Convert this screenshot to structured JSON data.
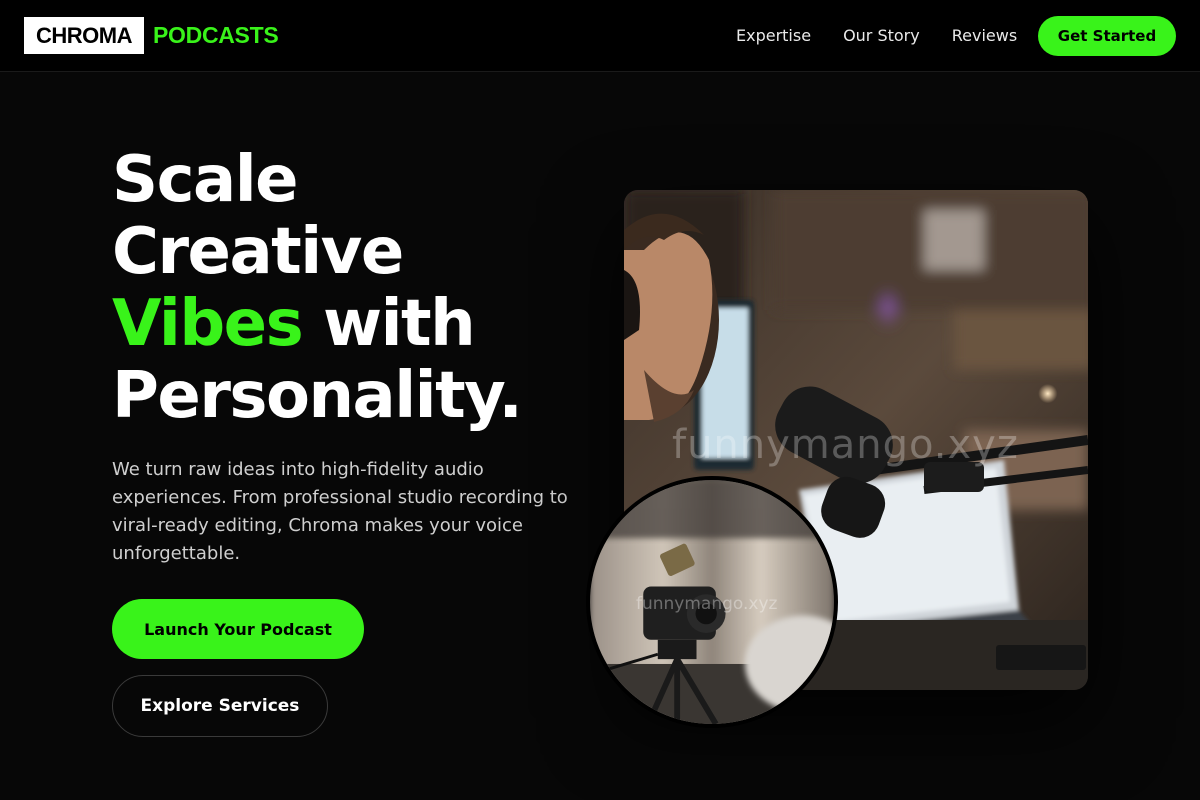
{
  "brand": {
    "name_box": "CHROMA",
    "name_accent": "PODCASTS",
    "accent_color": "#39f31a"
  },
  "nav": {
    "links": [
      "Expertise",
      "Our Story",
      "Reviews"
    ],
    "cta_label": "Get Started"
  },
  "hero": {
    "title_line1": "Scale",
    "title_line2": "Creative",
    "title_line3_accent": "Vibes",
    "title_line3_rest": " with",
    "title_line4": "Personality.",
    "description": "We turn raw ideas into high-fidelity audio experiences. From professional studio recording to viral-ready editing, Chroma makes your voice unforgettable.",
    "primary_button": "Launch Your Podcast",
    "secondary_button": "Explore Services"
  },
  "media": {
    "main_photo_icon": "podcast-studio-photo",
    "circle_photo_icon": "camera-tripod-photo",
    "watermark": "funnymango.xyz"
  }
}
